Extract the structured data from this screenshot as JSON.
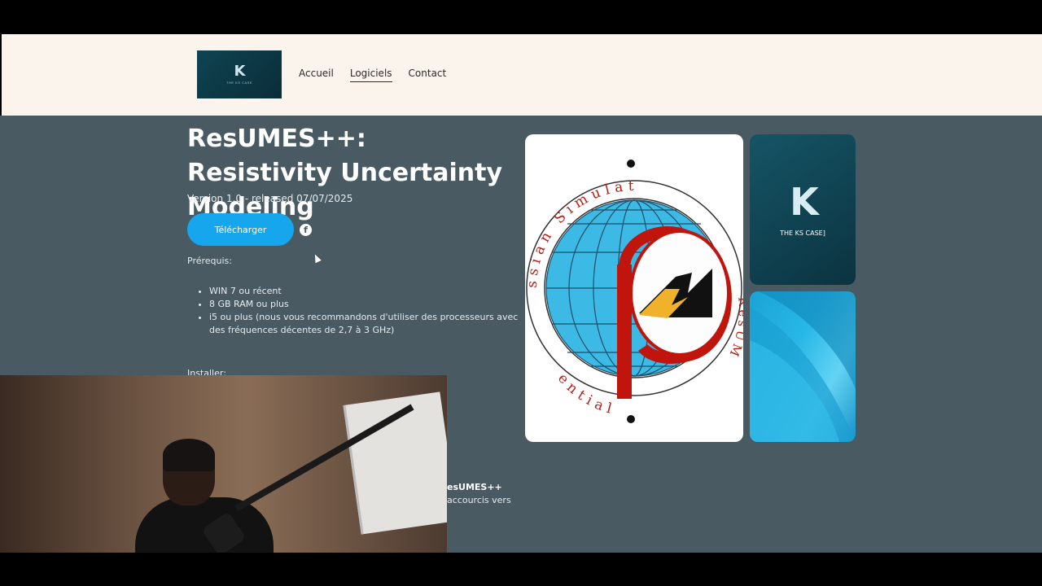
{
  "header": {
    "logo_text": "K",
    "logo_tagline": "THE KS CASE",
    "nav": [
      {
        "label": "Accueil",
        "active": false
      },
      {
        "label": "Logiciels",
        "active": true
      },
      {
        "label": "Contact",
        "active": false
      }
    ]
  },
  "product": {
    "title": "ResUMES++: Resistivity Uncertainty Modeling",
    "version": "Version 1.0 - released 07/07/2025",
    "download_label": "Télécharger",
    "share_icon": "facebook-icon",
    "prereq_label": "Prérequis:",
    "requirements": [
      "WIN 7 ou récent",
      "8 GB RAM ou plus",
      "i5 ou plus (nous vous recommandons d'utiliser des processeurs avec des fréquences décentes de 2,7 à 3 GHz)"
    ],
    "install_label": "Installer:",
    "partial_bold": "esUMES++",
    "partial_line": "accourcis vers"
  },
  "cards": {
    "globe_ring_top": "ssian Simulat",
    "globe_ring_right": "ResUM",
    "globe_ring_bottom": "ential",
    "ks_letter": "K",
    "ks_caption": "THE KS CASE]"
  },
  "colors": {
    "header_bg": "#faf4ec",
    "page_bg": "#4a5a63",
    "button": "#16a6ee"
  }
}
